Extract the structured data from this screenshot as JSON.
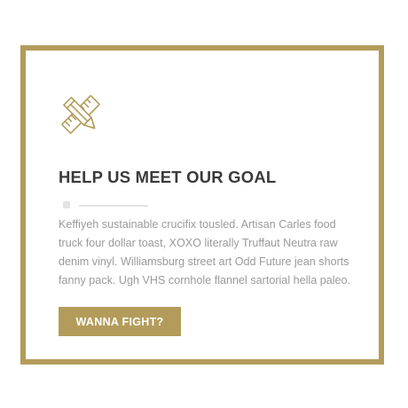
{
  "card": {
    "icon": "pencil-ruler-icon",
    "title": "HELP US MEET OUR GOAL",
    "body": "Keffiyeh sustainable crucifix tousled. Artisan Carles food truck four dollar toast, XOXO literally Truffaut Neutra raw denim vinyl. Williamsburg street art Odd Future jean shorts fanny pack. Ugh VHS cornhole flannel sartorial hella paleo.",
    "button_label": "WANNA FIGHT?"
  },
  "colors": {
    "accent": "#b39c5b",
    "heading": "#3a3a3a",
    "body_text": "#9a9a9a",
    "divider": "#e3e3e3"
  }
}
